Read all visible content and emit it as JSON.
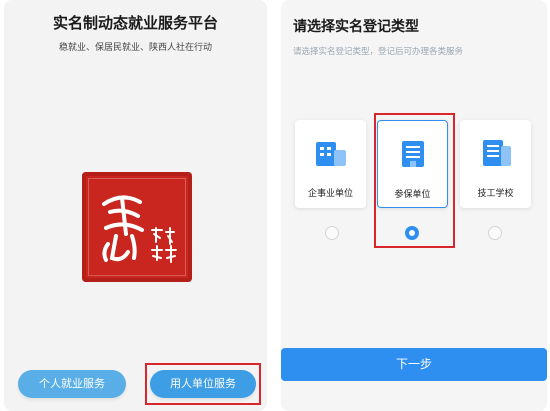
{
  "left_screen": {
    "title": "实名制动态就业服务平台",
    "subtitle": "稳就业、保居民就业、陕西人社在行动",
    "personal_button": "个人就业服务",
    "employer_button": "用人单位服务",
    "seal_colors": {
      "seal_red": "#c9261f"
    }
  },
  "right_screen": {
    "title": "请选择实名登记类型",
    "subtitle": "请选择实名登记类型，登记后可办理各类服务",
    "options": [
      {
        "label": "企事业单位",
        "icon": "enterprise-building-icon",
        "selected": false
      },
      {
        "label": "参保单位",
        "icon": "insured-unit-building-icon",
        "selected": true
      },
      {
        "label": "技工学校",
        "icon": "technical-school-icon",
        "selected": false
      }
    ],
    "next_button": "下一步"
  },
  "colors": {
    "accent": "#2f8ff0",
    "highlight_red": "#d9262c"
  }
}
